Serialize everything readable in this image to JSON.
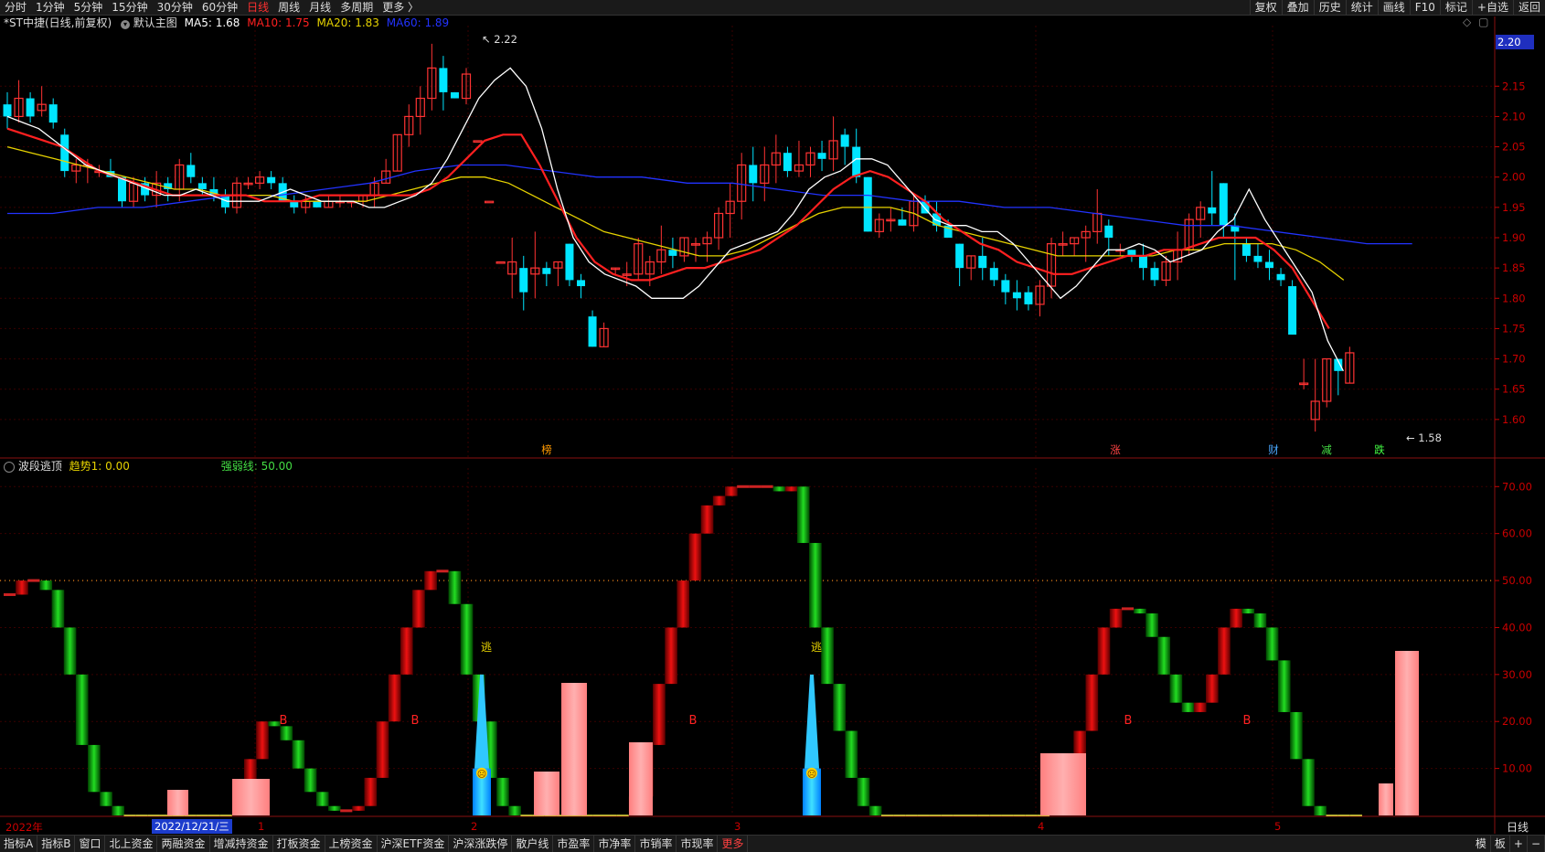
{
  "topbar": {
    "left": [
      "分时",
      "1分钟",
      "5分钟",
      "15分钟",
      "30分钟",
      "60分钟",
      "日线",
      "周线",
      "月线",
      "多周期",
      "更多 〉"
    ],
    "active": "日线",
    "right": [
      "复权",
      "叠加",
      "历史",
      "统计",
      "画线",
      "F10",
      "标记",
      "+自选",
      "返回"
    ]
  },
  "main_chart": {
    "title": "*ST中捷(日线,前复权)",
    "template": "默认主图",
    "ma5": "MA5: 1.68",
    "ma10": "MA10: 1.75",
    "ma20": "MA20: 1.83",
    "ma60": "MA60: 1.89",
    "price_badge": "2.20",
    "high_label": "2.22",
    "low_label": "1.58",
    "y_ticks": [
      "2.15",
      "2.10",
      "2.05",
      "2.00",
      "1.95",
      "1.90",
      "1.85",
      "1.80",
      "1.75",
      "1.70",
      "1.65",
      "1.60"
    ],
    "markers": [
      {
        "text": "榜",
        "color": "#ff9900"
      },
      {
        "text": "涨",
        "color": "#ff4444"
      },
      {
        "text": "财",
        "color": "#4aa8ff"
      },
      {
        "text": "减",
        "color": "#44dd44"
      },
      {
        "text": "跌",
        "color": "#44ff44"
      }
    ],
    "colors": {
      "up": "#ff3333",
      "down": "#00e5ff",
      "ma5": "#ffffff",
      "ma10": "#ff2020",
      "ma20": "#e6d200",
      "ma60": "#2233ff"
    }
  },
  "indicator": {
    "name": "波段逃顶",
    "trend": "趋势1: 0.00",
    "strength": "强弱线: 50.00",
    "y_ticks": [
      "70.00",
      "60.00",
      "50.00",
      "40.00",
      "30.00",
      "20.00",
      "10.00"
    ],
    "buy_label": "B",
    "escape_label": "逃",
    "emoji": "☹"
  },
  "x_axis": {
    "year_label": "2022年",
    "cursor_label": "2022/12/21/三",
    "month_labels": [
      "1",
      "2",
      "3",
      "4",
      "5"
    ],
    "period": "日线"
  },
  "bottombar": {
    "items": [
      "指标A",
      "指标B",
      "窗口",
      "北上资金",
      "两融资金",
      "增减持资金",
      "打板资金",
      "上榜资金",
      "沪深ETF资金",
      "沪深涨跌停",
      "散户线",
      "市盈率",
      "市净率",
      "市销率",
      "市现率",
      "更多"
    ],
    "right": [
      "模",
      "板",
      "+",
      "−"
    ]
  },
  "chart_data": [
    {
      "type": "line",
      "title": "*ST中捷(日线,前复权)",
      "series": [
        {
          "name": "MA5",
          "values": [
            2.1,
            2.09,
            2.08,
            2.06,
            2.04,
            2.02,
            2.01,
            2.0,
            1.99,
            1.98,
            1.97,
            1.97,
            1.98,
            1.97,
            1.96,
            1.96,
            1.96,
            1.97,
            1.98,
            1.97,
            1.96,
            1.96,
            1.96,
            1.95,
            1.95,
            1.96,
            1.97,
            1.99,
            2.03,
            2.08,
            2.13,
            2.16,
            2.18,
            2.15,
            2.08,
            1.98,
            1.9,
            1.86,
            1.84,
            1.83,
            1.82,
            1.8,
            1.8,
            1.8,
            1.82,
            1.85,
            1.88,
            1.89,
            1.9,
            1.91,
            1.94,
            1.98,
            2.0,
            2.01,
            2.03,
            2.03,
            2.02,
            1.99,
            1.96,
            1.93,
            1.92,
            1.92,
            1.91,
            1.91,
            1.89,
            1.86,
            1.83,
            1.8,
            1.82,
            1.85,
            1.88,
            1.88,
            1.89,
            1.88,
            1.86,
            1.87,
            1.88,
            1.91,
            1.93,
            1.98,
            1.93,
            1.89,
            1.85,
            1.81,
            1.73,
            1.68
          ]
        },
        {
          "name": "MA10",
          "values": [
            2.08,
            2.07,
            2.06,
            2.05,
            2.03,
            2.01,
            2.0,
            1.99,
            1.98,
            1.97,
            1.97,
            1.97,
            1.97,
            1.97,
            1.96,
            1.96,
            1.96,
            1.97,
            1.97,
            1.97,
            1.97,
            1.97,
            1.97,
            1.98,
            2.0,
            2.03,
            2.06,
            2.07,
            2.07,
            2.02,
            1.96,
            1.9,
            1.86,
            1.84,
            1.83,
            1.83,
            1.84,
            1.85,
            1.85,
            1.86,
            1.87,
            1.88,
            1.9,
            1.92,
            1.95,
            1.98,
            2.0,
            2.01,
            2.0,
            1.98,
            1.96,
            1.93,
            1.91,
            1.89,
            1.88,
            1.86,
            1.85,
            1.84,
            1.84,
            1.85,
            1.86,
            1.87,
            1.87,
            1.88,
            1.88,
            1.89,
            1.9,
            1.9,
            1.9,
            1.88,
            1.85,
            1.8,
            1.75
          ]
        },
        {
          "name": "MA20",
          "values": [
            2.05,
            2.04,
            2.03,
            2.02,
            2.01,
            2.0,
            1.99,
            1.98,
            1.98,
            1.97,
            1.97,
            1.97,
            1.96,
            1.96,
            1.96,
            1.96,
            1.97,
            1.98,
            1.99,
            2.0,
            2.0,
            1.99,
            1.97,
            1.95,
            1.93,
            1.91,
            1.9,
            1.89,
            1.88,
            1.87,
            1.87,
            1.88,
            1.9,
            1.92,
            1.94,
            1.95,
            1.95,
            1.95,
            1.94,
            1.92,
            1.91,
            1.9,
            1.89,
            1.88,
            1.87,
            1.87,
            1.87,
            1.87,
            1.87,
            1.88,
            1.88,
            1.89,
            1.89,
            1.89,
            1.88,
            1.86,
            1.83
          ]
        },
        {
          "name": "MA60",
          "values": [
            1.94,
            1.94,
            1.95,
            1.95,
            1.96,
            1.97,
            1.97,
            1.98,
            1.99,
            2.01,
            2.02,
            2.02,
            2.01,
            2.0,
            2.0,
            1.99,
            1.99,
            1.98,
            1.97,
            1.97,
            1.96,
            1.96,
            1.95,
            1.95,
            1.94,
            1.93,
            1.92,
            1.92,
            1.91,
            1.9,
            1.89,
            1.89
          ]
        }
      ]
    },
    {
      "type": "bar",
      "title": "波段逃顶",
      "ylim": [
        0,
        72
      ],
      "values": [
        47,
        50,
        50,
        48,
        40,
        30,
        15,
        5,
        2,
        0,
        0,
        0,
        0,
        0,
        0,
        0,
        0,
        0,
        0,
        2,
        12,
        20,
        19,
        16,
        10,
        5,
        2,
        1,
        1,
        2,
        8,
        20,
        30,
        40,
        48,
        52,
        52,
        45,
        30,
        20,
        8,
        2,
        0,
        0,
        0,
        0,
        0,
        0,
        0,
        0,
        0,
        0,
        4,
        15,
        28,
        40,
        50,
        60,
        66,
        68,
        70,
        70,
        70,
        70,
        69,
        70,
        58,
        40,
        28,
        18,
        8,
        2,
        0,
        0,
        0,
        0,
        0,
        0,
        0,
        0,
        0,
        0,
        0,
        0,
        0,
        0,
        0,
        2,
        8,
        18,
        30,
        40,
        44,
        44,
        43,
        38,
        30,
        24,
        22,
        24,
        30,
        40,
        44,
        43,
        40,
        33,
        22,
        12,
        2,
        0,
        0,
        0,
        0
      ]
    }
  ]
}
